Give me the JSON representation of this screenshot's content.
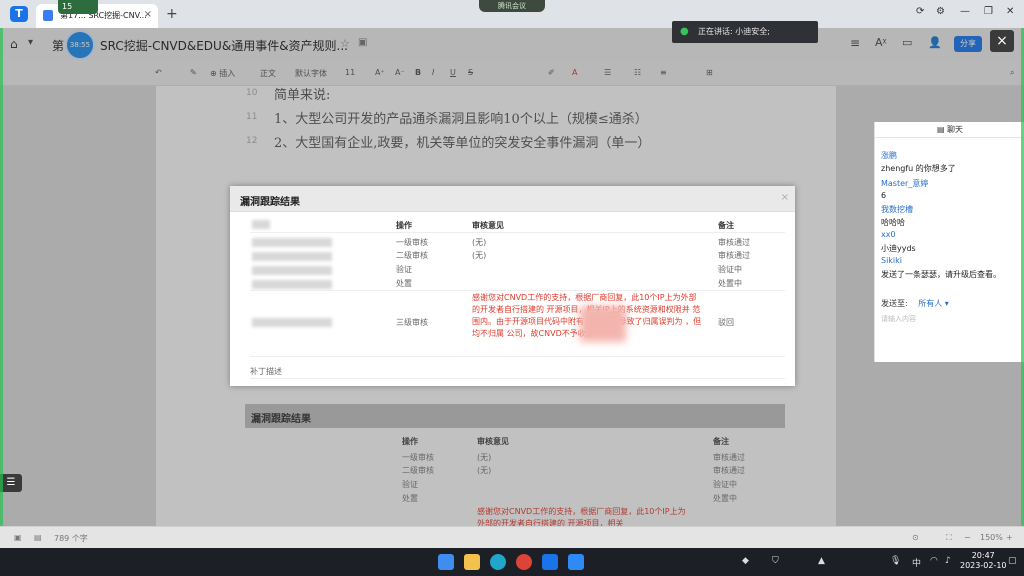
{
  "browser": {
    "tab_title": "第17... SRC挖掘-CNV...",
    "meeting_pill": "腾讯会议",
    "rec_badge": "15"
  },
  "doc": {
    "title_prefix": "第",
    "title": "SRC挖掘-CNVD&EDU&通用事件&资产规则...",
    "timer": "38:55",
    "share": "分享",
    "speaking": "正在讲话: 小迪安全;",
    "lines": [
      {
        "num": "10",
        "text": "简单来说:"
      },
      {
        "num": "11",
        "text": "1、大型公司开发的产品通杀漏洞且影响10个以上（规模≤通杀）"
      },
      {
        "num": "12",
        "text": "2、大型国有企业,政要，机关等单位的突发安全事件漏洞（单一）"
      }
    ]
  },
  "toolbar": {
    "insert": "插入",
    "style": "正文",
    "font": "默认字体",
    "size": "11"
  },
  "modal": {
    "title": "漏洞跟踪结果",
    "headers": {
      "op": "操作",
      "opinion": "审核意见",
      "note": "备注"
    },
    "rows": [
      {
        "op": "一级审核",
        "opinion": "(无)",
        "note": "审核通过"
      },
      {
        "op": "二级审核",
        "opinion": "(无)",
        "note": "审核通过"
      },
      {
        "op": "验证",
        "opinion": "",
        "note": "验证中"
      },
      {
        "op": "处置",
        "opinion": "",
        "note": "处置中"
      }
    ],
    "level3": {
      "op": "三级审核",
      "opinion": "感谢您对CNVD工作的支持，根据厂商回复，此10个IP上为外部的开发者自行搭建的 开源项目，相关IP上的系统资源和权限并 范围内。由于开源项目代码中附有 的标志，导致了归属误判为 ，但均不归属 公司，故CNVD不予收录",
      "note": "驳回"
    },
    "patch": "补丁描述"
  },
  "section2": {
    "title": "漏洞跟踪结果",
    "headers": {
      "op": "操作",
      "opinion": "审核意见",
      "note": "备注"
    },
    "rows": [
      {
        "op": "一级审核",
        "opinion": "(无)",
        "note": "审核通过"
      },
      {
        "op": "二级审核",
        "opinion": "(无)",
        "note": "审核通过"
      },
      {
        "op": "验证",
        "opinion": "",
        "note": "验证中"
      },
      {
        "op": "处置",
        "opinion": "",
        "note": "处置中"
      }
    ],
    "opinion_line1": "感谢您对CNVD工作的支持，根据厂商回复，此10个IP上为",
    "opinion_line2": "外部的开发者自行搭建的 开源项目，相关"
  },
  "chat": {
    "title": "聊天",
    "messages": [
      {
        "name": "涨鹏",
        "text": "zhengfu 的你想多了"
      },
      {
        "name": "Master_意婷",
        "text": "6"
      },
      {
        "name": "我数挖槽",
        "text": "哈哈哈"
      },
      {
        "name": "xx0",
        "text": "小迪yyds"
      },
      {
        "name": "Sikiki",
        "text": "发送了一条瑟瑟，请升级后查看。"
      }
    ],
    "send_to_label": "发送至:",
    "send_to_value": "所有人",
    "input_placeholder": "请输入内容"
  },
  "statusbar": {
    "word_count": "789 个字",
    "zoom": "150%"
  },
  "taskbar": {
    "time": "20:47",
    "date": "2023-02-10"
  }
}
